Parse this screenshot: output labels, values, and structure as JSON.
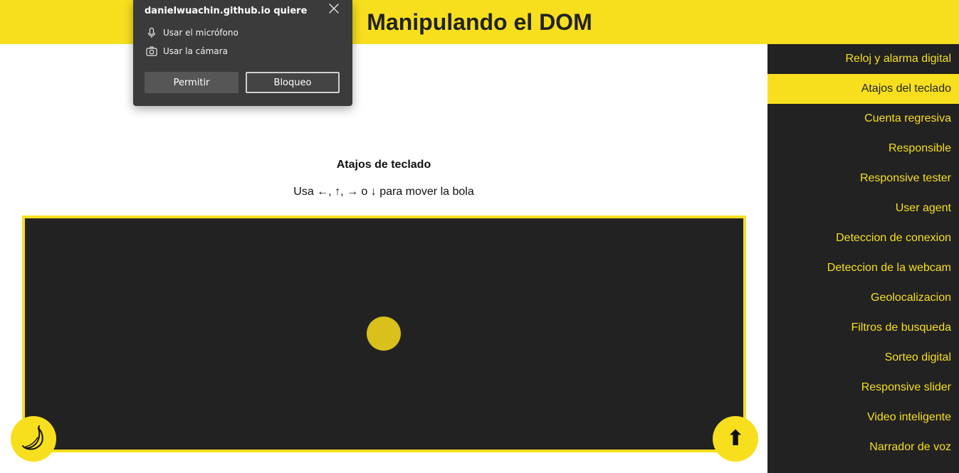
{
  "header": {
    "title": "Manipulando el DOM"
  },
  "sidebar": {
    "items": [
      {
        "label": "Reloj y alarma digital",
        "active": false
      },
      {
        "label": "Atajos del teclado",
        "active": true
      },
      {
        "label": "Cuenta regresiva",
        "active": false
      },
      {
        "label": "Responsible",
        "active": false
      },
      {
        "label": "Responsive tester",
        "active": false
      },
      {
        "label": "User agent",
        "active": false
      },
      {
        "label": "Deteccion de conexion",
        "active": false
      },
      {
        "label": "Deteccion de la webcam",
        "active": false
      },
      {
        "label": "Geolocalizacion",
        "active": false
      },
      {
        "label": "Filtros de busqueda",
        "active": false
      },
      {
        "label": "Sorteo digital",
        "active": false
      },
      {
        "label": "Responsive slider",
        "active": false
      },
      {
        "label": "Video inteligente",
        "active": false
      },
      {
        "label": "Narrador de voz",
        "active": false
      }
    ]
  },
  "main": {
    "section_title": "Atajos de teclado",
    "instructions": "Usa ←, ↑, → o ↓ para mover la bola"
  },
  "permission_popup": {
    "title": "danielwuachin.github.io quiere",
    "microphone_label": "Usar el micrófono",
    "camera_label": "Usar la cámara",
    "allow_label": "Permitir",
    "block_label": "Bloqueo"
  },
  "buttons": {
    "dark_mode_icon": "moon-icon",
    "scroll_top_icon": "arrow-up-icon",
    "scroll_top_glyph": "⬆"
  },
  "colors": {
    "accent": "#f7df1e",
    "dark": "#222222",
    "ball": "#d9c01b",
    "popup_bg": "#3b3b3b"
  }
}
